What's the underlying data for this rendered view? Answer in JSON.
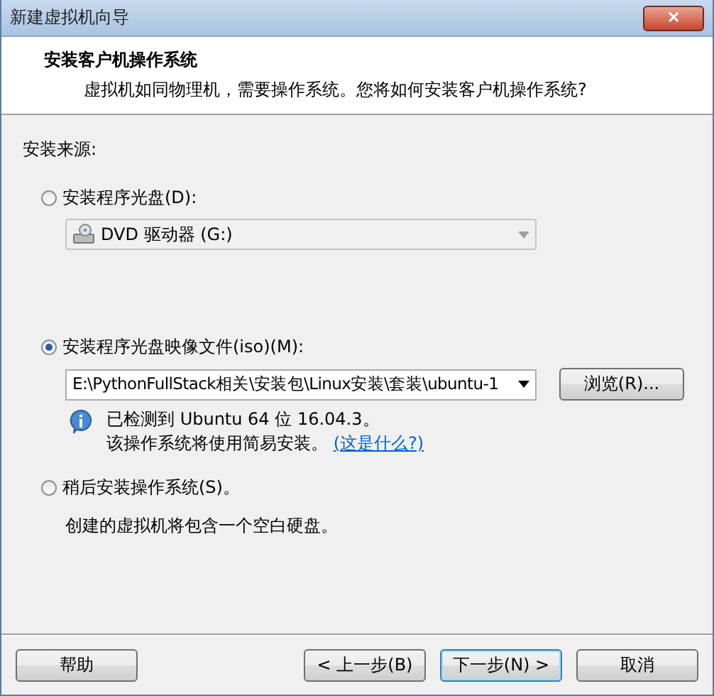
{
  "window": {
    "title": "新建虚拟机向导",
    "close": "✕"
  },
  "header": {
    "title": "安装客户机操作系统",
    "subtitle": "虚拟机如同物理机，需要操作系统。您将如何安装客户机操作系统?"
  },
  "source_label": "安装来源:",
  "disc": {
    "label": "安装程序光盘(D):",
    "selected": false,
    "drive": {
      "value": "DVD 驱动器 (G:)",
      "disabled": true
    }
  },
  "iso": {
    "label": "安装程序光盘映像文件(iso)(M):",
    "selected": true,
    "path": "E:\\PythonFullStack相关\\安装包\\Linux安装\\套装\\ubuntu-1",
    "browse": "浏览(R)...",
    "detected": "已检测到 Ubuntu 64 位 16.04.3。",
    "note": "该操作系统将使用简易安装。",
    "link": "(这是什么?)"
  },
  "later": {
    "label": "稍后安装操作系统(S)。",
    "selected": false,
    "description": "创建的虚拟机将包含一个空白硬盘。"
  },
  "buttons": [
    {
      "label": "帮助",
      "kind": "help",
      "default": false
    },
    {
      "label": "< 上一步(B)",
      "kind": "nav",
      "default": false
    },
    {
      "label": "下一步(N) >",
      "kind": "nav",
      "default": true
    },
    {
      "label": "取消",
      "kind": "cancel",
      "default": false
    }
  ]
}
